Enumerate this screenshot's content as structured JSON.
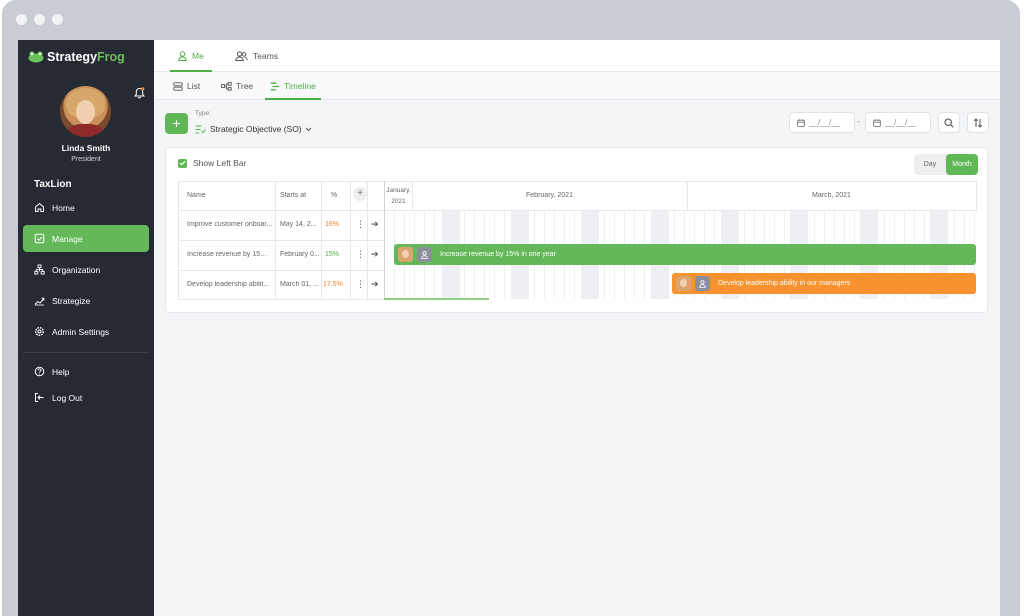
{
  "app": {
    "brand_part1": "Strategy",
    "brand_part2": "Frog"
  },
  "user": {
    "name": "Linda Smith",
    "role": "President"
  },
  "org": "TaxLion",
  "sidebar": {
    "items": [
      {
        "label": "Home",
        "icon": "home-icon"
      },
      {
        "label": "Manage",
        "icon": "check-square-icon",
        "active": true
      },
      {
        "label": "Organization",
        "icon": "org-chart-icon"
      },
      {
        "label": "Strategize",
        "icon": "trend-chart-icon"
      },
      {
        "label": "Admin Settings",
        "icon": "gear-icon"
      }
    ],
    "bottom": [
      {
        "label": "Help",
        "icon": "help-icon"
      },
      {
        "label": "Log Out",
        "icon": "logout-icon"
      }
    ]
  },
  "top_tabs": [
    {
      "label": "Me",
      "active": true
    },
    {
      "label": "Teams"
    }
  ],
  "sub_tabs": [
    {
      "label": "List"
    },
    {
      "label": "Tree"
    },
    {
      "label": "Timeline",
      "active": true
    }
  ],
  "toolbar": {
    "add_label": "+",
    "type_label": "Type:",
    "type_value": "Strategic Objective (SO)",
    "date_from": "__/__/__",
    "date_to": "__/__/__",
    "date_separator": "-"
  },
  "card": {
    "show_left_bar": "Show Left Bar",
    "view_day": "Day",
    "view_month": "Month"
  },
  "table": {
    "headers": {
      "name": "Name",
      "starts": "Starts at",
      "pct": "%",
      "add": "+"
    },
    "months": {
      "jan_1": "January,",
      "jan_2": "2021",
      "feb": "February, 2021",
      "mar": "March, 2021"
    },
    "rows": [
      {
        "name": "Improve customer onboar...",
        "starts": "May 14, 2...",
        "pct": "16%",
        "pct_color": "#f0812b"
      },
      {
        "name": "Increase revenue by 15% ...",
        "starts": "February 0...",
        "pct": "15%",
        "pct_color": "#4fae47"
      },
      {
        "name": "Develop leadership abilit...",
        "starts": "March 01, ...",
        "pct": "17.5%",
        "pct_color": "#f0812b"
      }
    ]
  },
  "bars": [
    {
      "label": "Increase revenue by 15% in one year",
      "color": "#64b85a"
    },
    {
      "label": "Develop leadership ability in our managers",
      "color": "#f7922e"
    }
  ],
  "colors": {
    "accent": "#5fb855",
    "sidebar": "#262a33",
    "orange": "#f7922e"
  }
}
